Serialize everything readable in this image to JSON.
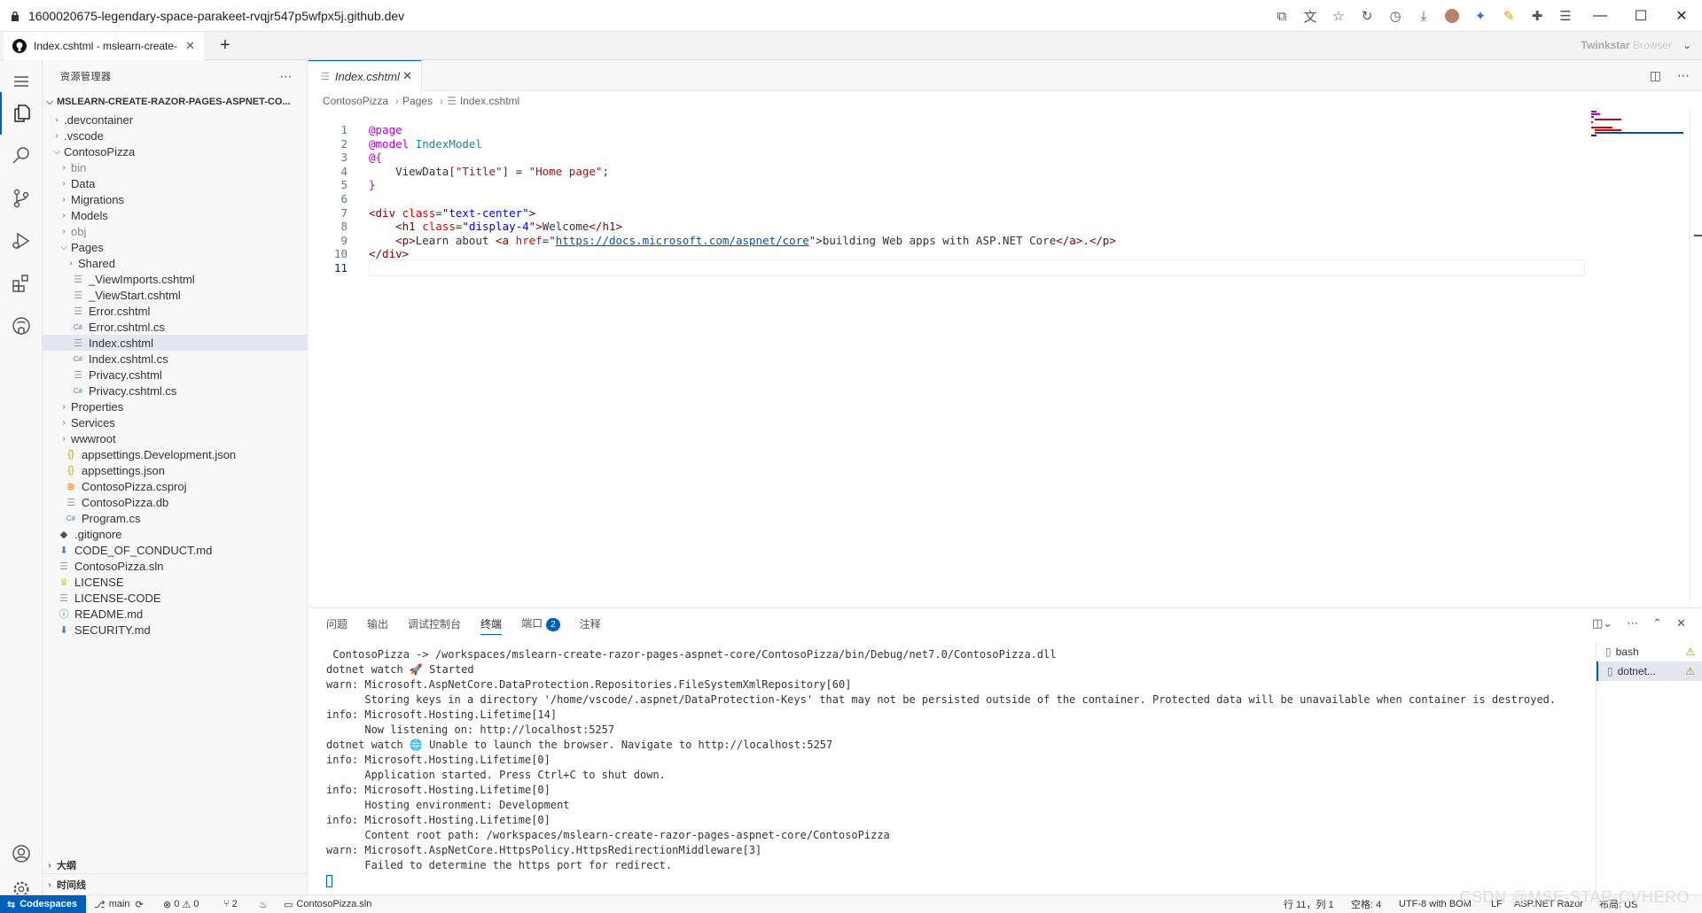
{
  "browser": {
    "url": "1600020675-legendary-space-parakeet-rvqjr547p5wfpx5j.github.dev",
    "tab_title": "Index.cshtml - mslearn-create-",
    "brand": "Twinkstar",
    "brand_sub": "Browser"
  },
  "sidebar": {
    "title": "资源管理器",
    "root": "MSLEARN-CREATE-RAZOR-PAGES-ASPNET-CO...",
    "tree": [
      {
        "label": ".devcontainer",
        "type": "folder",
        "depth": 1,
        "open": false
      },
      {
        "label": ".vscode",
        "type": "folder",
        "depth": 1,
        "open": false
      },
      {
        "label": "ContosoPizza",
        "type": "folder",
        "depth": 1,
        "open": true
      },
      {
        "label": "bin",
        "type": "folder",
        "depth": 2,
        "open": false,
        "dim": true
      },
      {
        "label": "Data",
        "type": "folder",
        "depth": 2,
        "open": false
      },
      {
        "label": "Migrations",
        "type": "folder",
        "depth": 2,
        "open": false
      },
      {
        "label": "Models",
        "type": "folder",
        "depth": 2,
        "open": false
      },
      {
        "label": "obj",
        "type": "folder",
        "depth": 2,
        "open": false,
        "dim": true
      },
      {
        "label": "Pages",
        "type": "folder",
        "depth": 2,
        "open": true
      },
      {
        "label": "Shared",
        "type": "folder",
        "depth": 3,
        "open": false
      },
      {
        "label": "_ViewImports.cshtml",
        "type": "razor",
        "depth": 3
      },
      {
        "label": "_ViewStart.cshtml",
        "type": "razor",
        "depth": 3
      },
      {
        "label": "Error.cshtml",
        "type": "razor",
        "depth": 3
      },
      {
        "label": "Error.cshtml.cs",
        "type": "cs",
        "depth": 3
      },
      {
        "label": "Index.cshtml",
        "type": "razor",
        "depth": 3,
        "selected": true
      },
      {
        "label": "Index.cshtml.cs",
        "type": "cs",
        "depth": 3
      },
      {
        "label": "Privacy.cshtml",
        "type": "razor",
        "depth": 3
      },
      {
        "label": "Privacy.cshtml.cs",
        "type": "cs",
        "depth": 3
      },
      {
        "label": "Properties",
        "type": "folder",
        "depth": 2,
        "open": false
      },
      {
        "label": "Services",
        "type": "folder",
        "depth": 2,
        "open": false
      },
      {
        "label": "wwwroot",
        "type": "folder",
        "depth": 2,
        "open": false
      },
      {
        "label": "appsettings.Development.json",
        "type": "json",
        "depth": 2
      },
      {
        "label": "appsettings.json",
        "type": "json",
        "depth": 2
      },
      {
        "label": "ContosoPizza.csproj",
        "type": "rss",
        "depth": 2
      },
      {
        "label": "ContosoPizza.db",
        "type": "db",
        "depth": 2
      },
      {
        "label": "Program.cs",
        "type": "cs",
        "depth": 2
      },
      {
        "label": ".gitignore",
        "type": "git",
        "depth": 1
      },
      {
        "label": "CODE_OF_CONDUCT.md",
        "type": "md",
        "depth": 1
      },
      {
        "label": "ContosoPizza.sln",
        "type": "sln",
        "depth": 1
      },
      {
        "label": "LICENSE",
        "type": "license",
        "depth": 1
      },
      {
        "label": "LICENSE-CODE",
        "type": "text",
        "depth": 1
      },
      {
        "label": "README.md",
        "type": "info",
        "depth": 1
      },
      {
        "label": "SECURITY.md",
        "type": "md",
        "depth": 1
      }
    ],
    "outline": "大纲",
    "timeline": "时间线"
  },
  "editor": {
    "tab": "Index.cshtml",
    "breadcrumb": [
      "ContosoPizza",
      "Pages",
      "Index.cshtml"
    ],
    "lines": [
      [
        [
          "@page",
          "d"
        ]
      ],
      [
        [
          "@model ",
          "d"
        ],
        [
          "IndexModel",
          "m"
        ]
      ],
      [
        [
          "@{",
          "d"
        ]
      ],
      [
        [
          "    ViewData[",
          ""
        ],
        [
          "\"Title\"",
          "s"
        ],
        [
          "] = ",
          ""
        ],
        [
          "\"Home page\"",
          "s"
        ],
        [
          ";",
          ""
        ]
      ],
      [
        [
          "}",
          "d"
        ]
      ],
      [
        [
          "",
          ""
        ]
      ],
      [
        [
          "<",
          "t"
        ],
        [
          "div ",
          "t"
        ],
        [
          "class",
          "a"
        ],
        [
          "=",
          ""
        ],
        [
          "\"text-center\"",
          "k"
        ],
        [
          ">",
          "t"
        ]
      ],
      [
        [
          "    <",
          "t"
        ],
        [
          "h1 ",
          "t"
        ],
        [
          "class",
          "a"
        ],
        [
          "=",
          ""
        ],
        [
          "\"display-4\"",
          "k"
        ],
        [
          ">",
          "t"
        ],
        [
          "Welcome",
          ""
        ],
        [
          "</h1>",
          "t"
        ]
      ],
      [
        [
          "    <",
          "t"
        ],
        [
          "p",
          "t"
        ],
        [
          ">",
          "t"
        ],
        [
          "Learn about ",
          ""
        ],
        [
          "<",
          "t"
        ],
        [
          "a ",
          "t"
        ],
        [
          "href",
          "a"
        ],
        [
          "=\"",
          ""
        ],
        [
          "https://docs.microsoft.com/aspnet/core",
          "link"
        ],
        [
          "\"",
          ""
        ],
        [
          ">",
          "t"
        ],
        [
          "building Web apps with ASP.NET Core",
          ""
        ],
        [
          "</a>",
          "t"
        ],
        [
          ".",
          ""
        ],
        [
          "</p>",
          "t"
        ]
      ],
      [
        [
          "</div>",
          "t"
        ]
      ],
      [
        [
          "",
          ""
        ]
      ]
    ],
    "current_line": 11
  },
  "panel": {
    "tabs": [
      "问题",
      "输出",
      "调试控制台",
      "终端",
      "端口",
      "注释"
    ],
    "active_tab": "终端",
    "ports_badge": "2",
    "terminal_lines": [
      " ContosoPizza -> /workspaces/mslearn-create-razor-pages-aspnet-core/ContosoPizza/bin/Debug/net7.0/ContosoPizza.dll",
      "dotnet watch 🚀 Started",
      "warn: Microsoft.AspNetCore.DataProtection.Repositories.FileSystemXmlRepository[60]",
      "      Storing keys in a directory '/home/vscode/.aspnet/DataProtection-Keys' that may not be persisted outside of the container. Protected data will be unavailable when container is destroyed.",
      "info: Microsoft.Hosting.Lifetime[14]",
      "      Now listening on: http://localhost:5257",
      "dotnet watch 🌐 Unable to launch the browser. Navigate to http://localhost:5257",
      "info: Microsoft.Hosting.Lifetime[0]",
      "      Application started. Press Ctrl+C to shut down.",
      "info: Microsoft.Hosting.Lifetime[0]",
      "      Hosting environment: Development",
      "info: Microsoft.Hosting.Lifetime[0]",
      "      Content root path: /workspaces/mslearn-create-razor-pages-aspnet-core/ContosoPizza",
      "warn: Microsoft.AspNetCore.HttpsPolicy.HttpsRedirectionMiddleware[3]",
      "      Failed to determine the https port for redirect."
    ],
    "terminals": [
      {
        "name": "bash",
        "selected": false
      },
      {
        "name": "dotnet...",
        "selected": true
      }
    ]
  },
  "status": {
    "remote": "Codespaces",
    "branch": "main",
    "problems": "0",
    "warnings": "0",
    "ports": "2",
    "solution": "ContosoPizza.sln",
    "position": "行 11，列 1",
    "spaces": "空格: 4",
    "encoding": "UTF-8 with BOM",
    "eol": "LF",
    "language": "ASP.NET Razor",
    "layout": "布局: US"
  },
  "watermark": "CSDN @MSE-STAR-CVHERO"
}
